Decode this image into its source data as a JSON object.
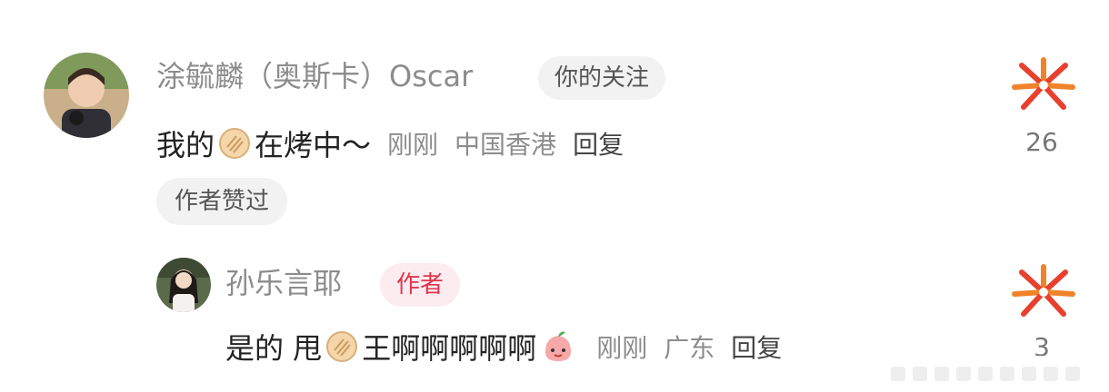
{
  "comments": [
    {
      "username": "涂毓麟（奥斯卡）Oscar",
      "badge": "你的关注",
      "text_before": "我的",
      "emoji_1": "cookie-emoji",
      "text_after": "在烤中～",
      "time": "刚刚",
      "location": "中国香港",
      "reply_label": "回复",
      "liked_label": "作者赞过",
      "like_count": "26"
    },
    {
      "username": "孙乐言耶",
      "badge": "作者",
      "text_before": "是的 甩",
      "emoji_1": "cookie-emoji",
      "text_after": "王啊啊啊啊啊",
      "emoji_2": "peach-face-emoji",
      "time": "刚刚",
      "location": "广东",
      "reply_label": "回复",
      "like_count": "3"
    }
  ],
  "colors": {
    "author_badge_text": "#e0344f",
    "author_badge_bg": "#fdecef",
    "follow_badge_bg": "#f2f2f2"
  }
}
